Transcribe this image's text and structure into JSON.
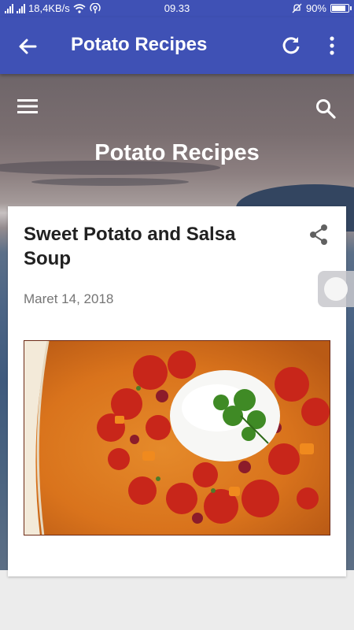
{
  "status_bar": {
    "network_speed": "18,4KB/s",
    "time": "09.33",
    "battery": "90%",
    "battery_level": 0.9
  },
  "app_bar": {
    "title": "Potato Recipes",
    "back_icon": "arrow-back-icon",
    "refresh_icon": "refresh-icon",
    "more_icon": "more-vert-icon"
  },
  "hero": {
    "blog_title": "Potato Recipes",
    "menu_icon": "hamburger-menu-icon",
    "search_icon": "search-icon"
  },
  "post": {
    "title": "Sweet Potato and Salsa Soup",
    "date": "Maret 14, 2018",
    "share_icon": "share-icon"
  },
  "colors": {
    "primary": "#3f51b5",
    "text_dark": "#212121",
    "text_muted": "#757575"
  }
}
